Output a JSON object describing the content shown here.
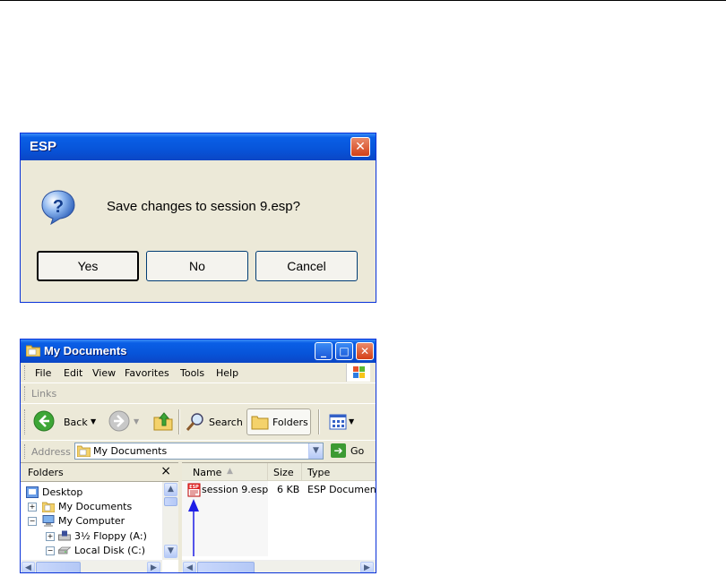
{
  "dialog": {
    "title": "ESP",
    "message": "Save changes to session 9.esp?",
    "close_glyph": "✕",
    "icon": "question-icon",
    "buttons": {
      "yes": "Yes",
      "no": "No",
      "cancel": "Cancel"
    }
  },
  "explorer": {
    "title": "My Documents",
    "caption_buttons": {
      "minimize": "_",
      "maximize": "□",
      "close": "✕"
    },
    "menu": [
      "File",
      "Edit",
      "View",
      "Favorites",
      "Tools",
      "Help"
    ],
    "links_label": "Links",
    "toolbar": {
      "back": "Back",
      "search": "Search",
      "folders": "Folders"
    },
    "address": {
      "label": "Address",
      "value": "My Documents",
      "go": "Go"
    },
    "folders_pane": {
      "title": "Folders",
      "close": "×",
      "items": [
        "Desktop",
        "My Documents",
        "My Computer",
        "3½ Floppy (A:)",
        "Local Disk (C:)"
      ]
    },
    "columns": {
      "name": "Name",
      "size": "Size",
      "type": "Type"
    },
    "files": [
      {
        "name": "session 9.esp",
        "size": "6 KB",
        "type": "ESP Document"
      }
    ]
  }
}
